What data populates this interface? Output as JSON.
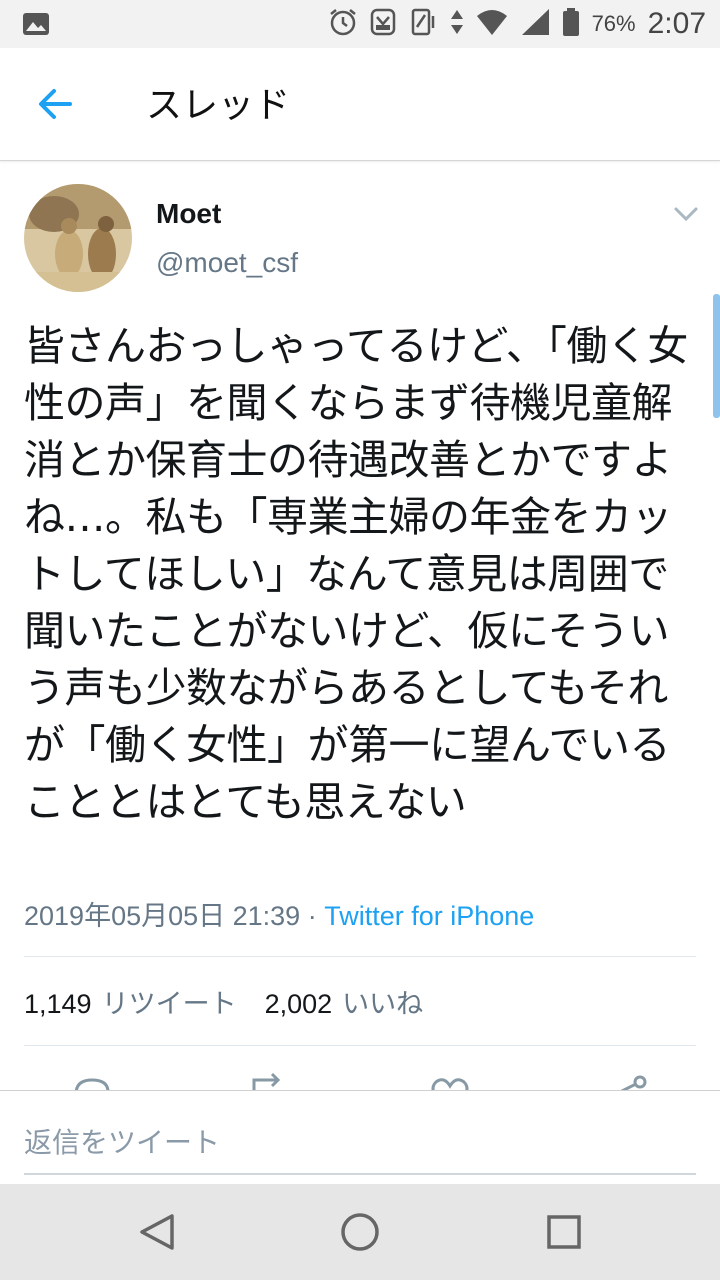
{
  "status_bar": {
    "battery_percent": "76%",
    "time": "2:07",
    "icons": [
      "image-icon",
      "alarm-icon",
      "ribbon-icon",
      "vibrate-icon",
      "data-arrows-icon",
      "wifi-icon",
      "signal-icon",
      "battery-icon"
    ]
  },
  "header": {
    "title": "スレッド"
  },
  "tweet": {
    "name": "Moet",
    "handle": "@moet_csf",
    "text": "皆さんおっしゃってるけど、「働く女性の声」を聞くならまず待機児童解消とか保育士の待遇改善とかですよね…。私も「専業主婦の年金をカットしてほしい」なんて意見は周囲で聞いたことがないけど、仮にそういう声も少数ながらあるとしてもそれが「働く女性」が第一に望んでいることとはとても思えない",
    "date": "2019年05月05日 21:39",
    "separator": " · ",
    "source": "Twitter for iPhone",
    "retweets": "1,149",
    "retweets_label": "リツイート",
    "likes": "2,002",
    "likes_label": "いいね"
  },
  "reply": {
    "placeholder": "返信をツイート"
  },
  "colors": {
    "accent": "#1da1f2",
    "secondary_text": "#657786"
  }
}
